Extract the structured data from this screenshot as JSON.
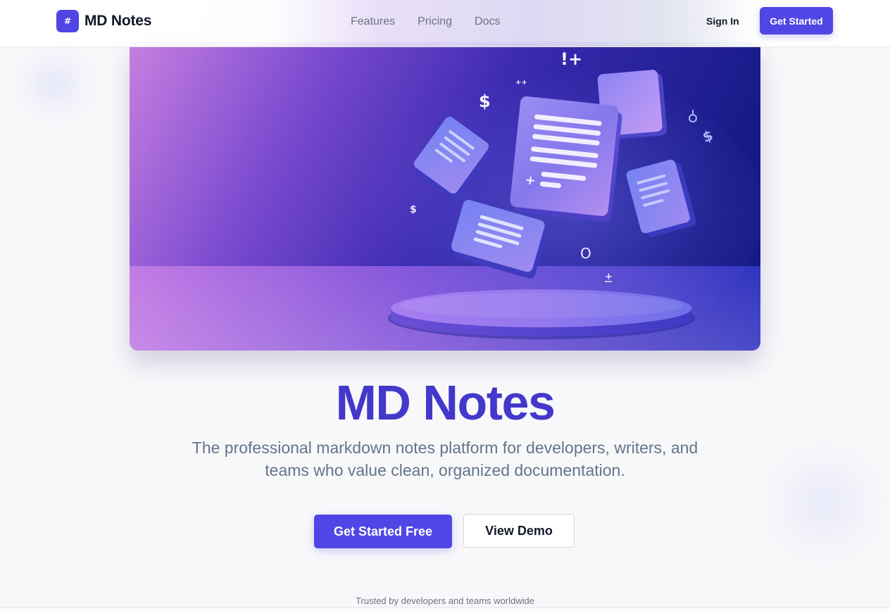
{
  "header": {
    "logo_glyph": "#",
    "brand": "MD Notes",
    "nav": [
      "Features",
      "Pricing",
      "Docs"
    ],
    "sign_in": "Sign In",
    "cta": "Get Started"
  },
  "hero": {
    "illustration_glyphs": [
      "!+",
      "++",
      "$",
      "$",
      "$",
      "+",
      "O"
    ],
    "title": "MD Notes",
    "subtitle_line1": "The professional markdown notes platform for developers, writers, and",
    "subtitle_line2": "teams who value clean, organized documentation.",
    "primary_cta": "Get Started Free",
    "secondary_cta": "View Demo",
    "trusted": "Trusted by developers and teams worldwide"
  },
  "colors": {
    "brand": "#4f46e5",
    "title": "#4338ca",
    "subtitle": "#64748b"
  },
  "icons": {
    "logo": "hash-icon"
  }
}
